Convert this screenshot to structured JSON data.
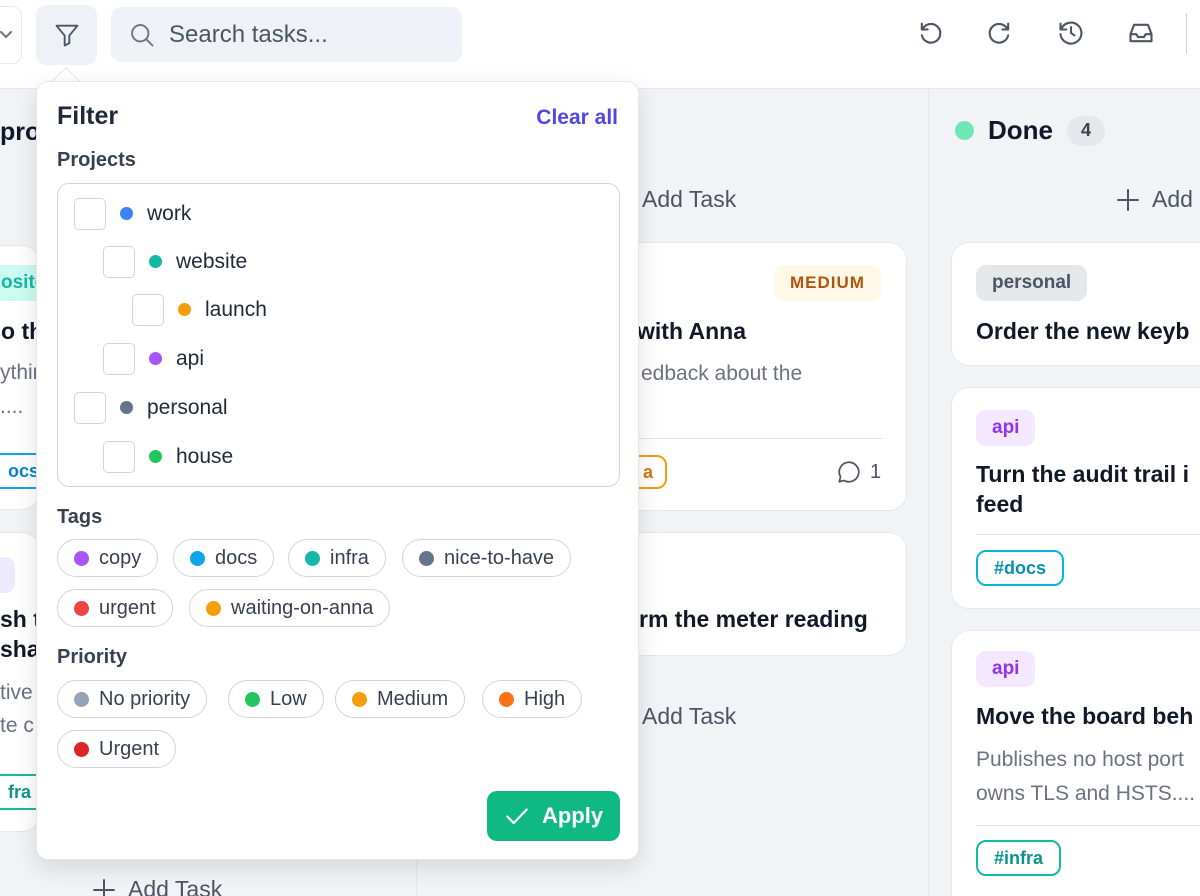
{
  "toolbar": {
    "search_placeholder": "Search tasks...",
    "icons": [
      "chevron-down-icon",
      "filter-icon",
      "search-icon",
      "undo-icon",
      "redo-icon",
      "history-icon",
      "inbox-icon"
    ]
  },
  "columns": {
    "left": {
      "heading_fragment": "pro",
      "tag_fragment": "osite",
      "title_fragment": "o the",
      "desc1": "ythin",
      "desc2": "....",
      "hashtag_fragment": "ocs",
      "title2a": "sh t",
      "title2b": "sha",
      "desc3": "tive",
      "desc4": "te c",
      "hashtag2_fragment": "fra",
      "add_task": "Add Task"
    },
    "middle": {
      "add_task_top": "Add Task",
      "card1": {
        "priority": "MEDIUM",
        "title": "with Anna",
        "desc": "edback about the",
        "tag_fragment": "a",
        "comment_count": "1"
      },
      "card2": {
        "title": "rm the meter reading"
      },
      "add_task_bottom": "Add Task"
    },
    "done": {
      "name": "Done",
      "count": "4",
      "add_task": "Add",
      "cards": [
        {
          "tag": "personal",
          "title": "Order the new keyb"
        },
        {
          "tag": "api",
          "title": "Turn the audit trail i",
          "title2": "feed",
          "hashtag": "#docs"
        },
        {
          "tag": "api",
          "title": "Move the board beh",
          "desc1": "Publishes no host port",
          "desc2": "owns TLS and HSTS....",
          "hashtag": "#infra"
        }
      ]
    }
  },
  "filter": {
    "title": "Filter",
    "clear_all": "Clear all",
    "projects_label": "Projects",
    "projects": [
      {
        "name": "work",
        "color": "#3b82f6",
        "indent": 0
      },
      {
        "name": "website",
        "color": "#14b8a6",
        "indent": 1
      },
      {
        "name": "launch",
        "color": "#f59e0b",
        "indent": 2
      },
      {
        "name": "api",
        "color": "#a855f7",
        "indent": 1
      },
      {
        "name": "personal",
        "color": "#64748b",
        "indent": 0
      },
      {
        "name": "house",
        "color": "#22c55e",
        "indent": 1
      }
    ],
    "tags_label": "Tags",
    "tags": [
      {
        "name": "copy",
        "color": "#a855f7"
      },
      {
        "name": "docs",
        "color": "#0ea5e9"
      },
      {
        "name": "infra",
        "color": "#14b8a6"
      },
      {
        "name": "nice-to-have",
        "color": "#64748b"
      },
      {
        "name": "urgent",
        "color": "#ef4444"
      },
      {
        "name": "waiting-on-anna",
        "color": "#f59e0b"
      }
    ],
    "priority_label": "Priority",
    "priorities": [
      {
        "name": "No priority",
        "color": "#94a3b8"
      },
      {
        "name": "Low",
        "color": "#22c55e"
      },
      {
        "name": "Medium",
        "color": "#f59e0b"
      },
      {
        "name": "High",
        "color": "#f97316"
      },
      {
        "name": "Urgent",
        "color": "#dc2626"
      }
    ],
    "apply": "Apply"
  }
}
